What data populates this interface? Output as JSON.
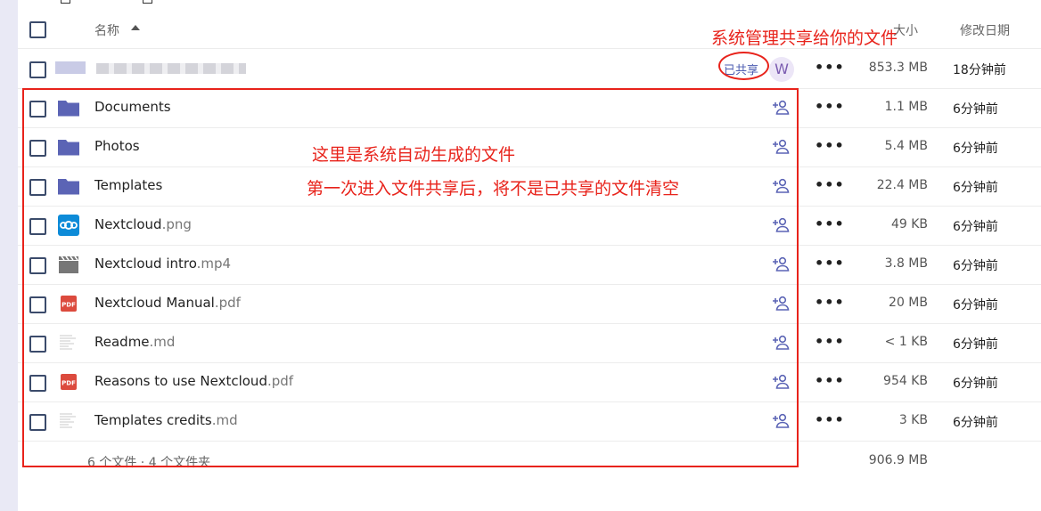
{
  "header": {
    "name_label": "名称",
    "size_label": "大小",
    "date_label": "修改日期"
  },
  "shared_row": {
    "shared_badge": "已共享",
    "avatar_letter": "W",
    "more_label": "•••",
    "size": "853.3 MB",
    "modified": "18分钟前"
  },
  "files": [
    {
      "name": "Documents",
      "ext": "",
      "icon": "folder-icon",
      "size": "1.1 MB",
      "modified": "6分钟前"
    },
    {
      "name": "Photos",
      "ext": "",
      "icon": "folder-icon",
      "size": "5.4 MB",
      "modified": "6分钟前"
    },
    {
      "name": "Templates",
      "ext": "",
      "icon": "folder-icon",
      "size": "22.4 MB",
      "modified": "6分钟前"
    },
    {
      "name": "Nextcloud",
      "ext": ".png",
      "icon": "nextcloud-logo-icon",
      "size": "49 KB",
      "modified": "6分钟前"
    },
    {
      "name": "Nextcloud intro",
      "ext": ".mp4",
      "icon": "video-clapper-icon",
      "size": "3.8 MB",
      "modified": "6分钟前"
    },
    {
      "name": "Nextcloud Manual",
      "ext": ".pdf",
      "icon": "pdf-icon",
      "size": "20 MB",
      "modified": "6分钟前"
    },
    {
      "name": "Readme",
      "ext": ".md",
      "icon": "text-file-icon",
      "size": "< 1 KB",
      "modified": "6分钟前"
    },
    {
      "name": "Reasons to use Nextcloud",
      "ext": ".pdf",
      "icon": "pdf-icon",
      "size": "954 KB",
      "modified": "6分钟前"
    },
    {
      "name": "Templates credits",
      "ext": ".md",
      "icon": "text-file-icon",
      "size": "3 KB",
      "modified": "6分钟前"
    }
  ],
  "more_label": "•••",
  "pdf_label": "PDF",
  "footer": {
    "summary": "6 个文件 · 4 个文件夹",
    "total": "906.9 MB"
  },
  "annotations": {
    "shared_note": "系统管理共享给你的文件",
    "auto_note": "这里是系统自动生成的文件",
    "clear_note": "第一次进入文件共享后，将不是已共享的文件清空"
  },
  "colors": {
    "accent": "#5b64b5",
    "annotation": "#e8231b",
    "folder": "#5b64b5",
    "nextcloud": "#0d8bd8",
    "pdf": "#dc4a3d"
  }
}
